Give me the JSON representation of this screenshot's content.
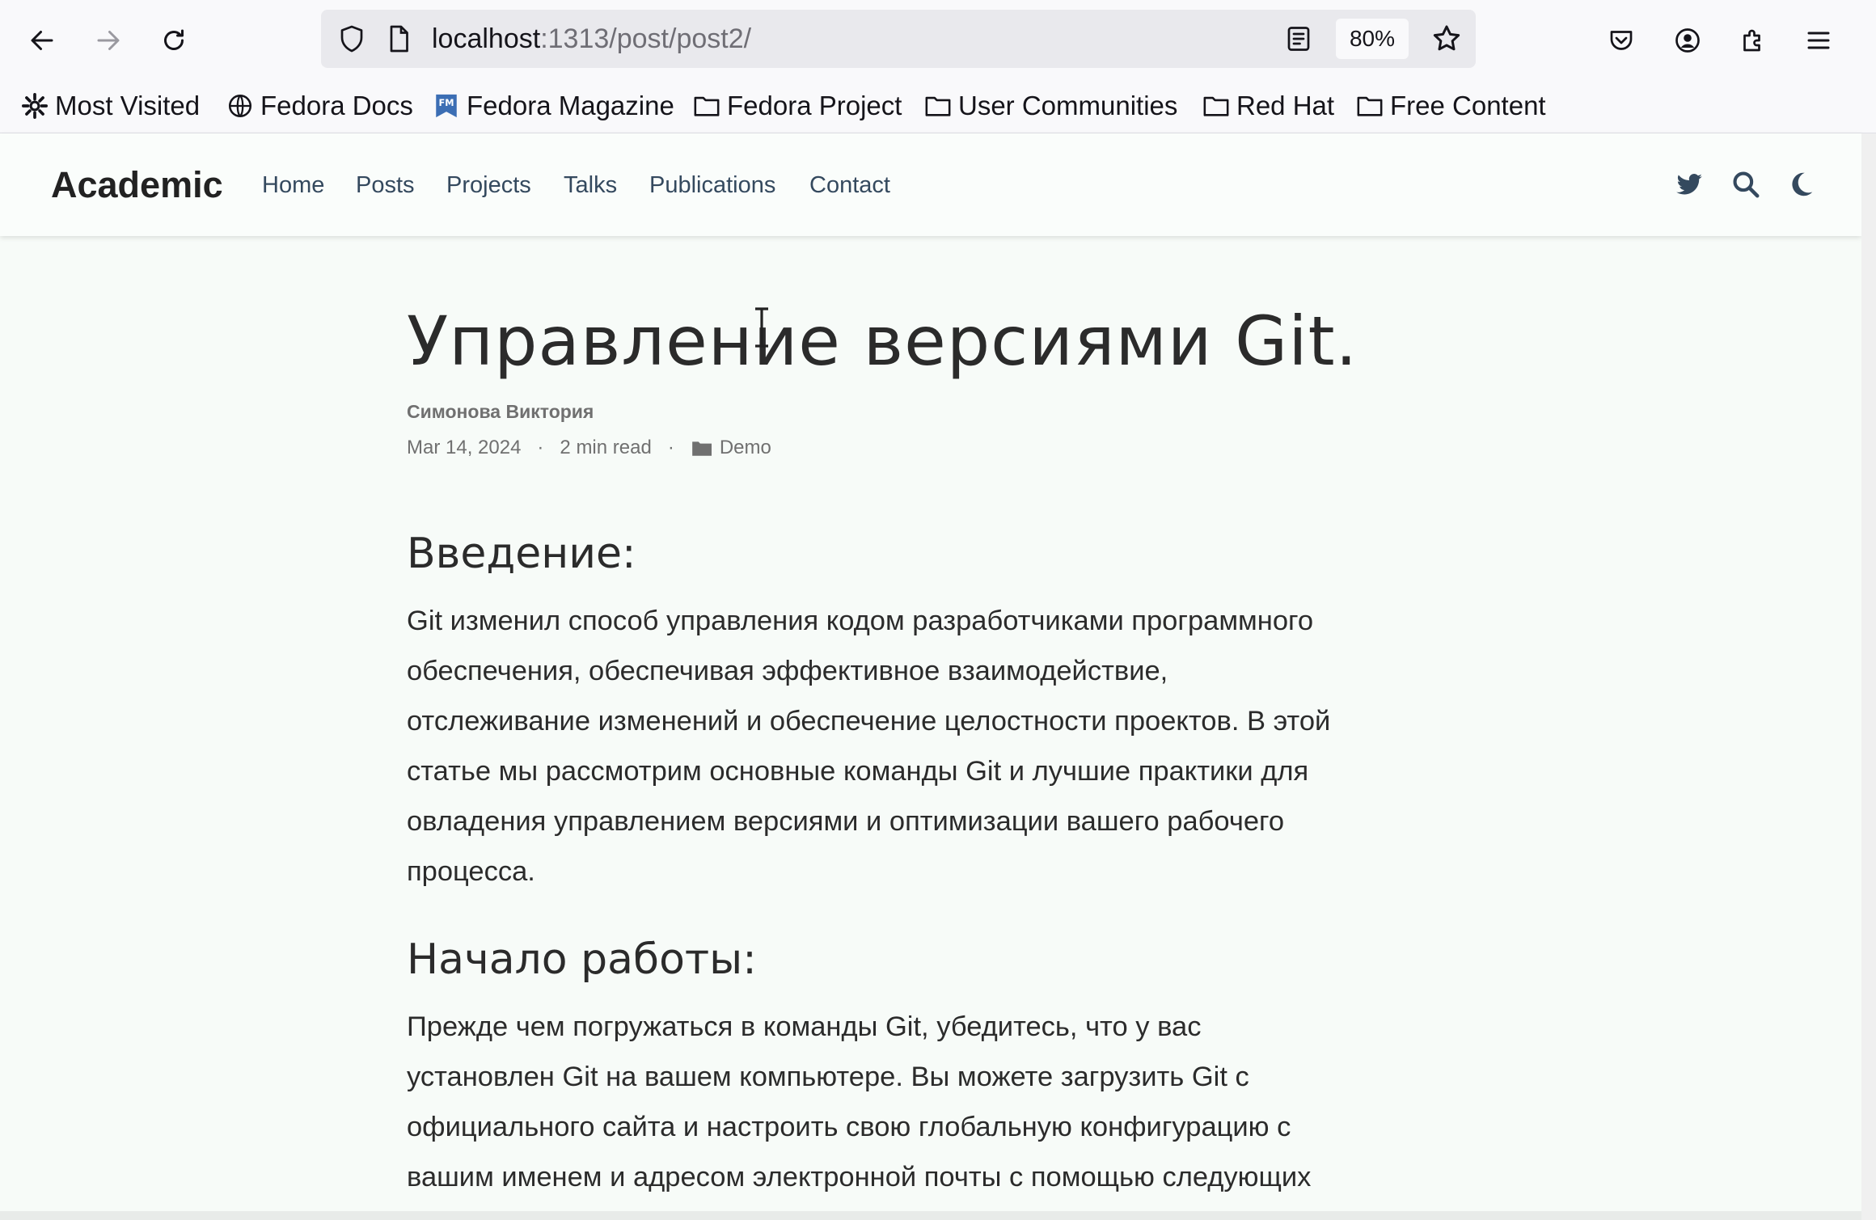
{
  "browser": {
    "url_host": "localhost",
    "url_path": ":1313/post/post2/",
    "zoom": "80%"
  },
  "bookmarks": [
    {
      "label": "Most Visited",
      "icon": "gear-icon"
    },
    {
      "label": "Fedora Docs",
      "icon": "globe-icon"
    },
    {
      "label": "Fedora Magazine",
      "icon": "fedora-magazine-icon"
    },
    {
      "label": "Fedora Project",
      "icon": "folder-icon"
    },
    {
      "label": "User Communities",
      "icon": "folder-icon"
    },
    {
      "label": "Red Hat",
      "icon": "folder-icon"
    },
    {
      "label": "Free Content",
      "icon": "folder-icon"
    }
  ],
  "site": {
    "brand": "Academic",
    "nav": [
      "Home",
      "Posts",
      "Projects",
      "Talks",
      "Publications",
      "Contact"
    ],
    "nav_icons": [
      "twitter-icon",
      "search-icon",
      "moon-icon"
    ]
  },
  "article": {
    "title": "Управление версиями Git.",
    "author": "Симонова Виктория",
    "date": "Mar 14, 2024",
    "reading_time": "2 min read",
    "category": "Demo",
    "sections": [
      {
        "heading": "Введение:",
        "lines": [
          "Git изменил способ управления кодом разработчиками программного",
          "обеспечения, обеспечивая эффективное взаимодействие,",
          "отслеживание изменений и обеспечение целостности проектов. В этой",
          "статье мы рассмотрим основные команды Git и лучшие практики для",
          "овладения управлением версиями и оптимизации вашего рабочего",
          "процесса."
        ]
      },
      {
        "heading": "Начало работы:",
        "lines": [
          "Прежде чем погружаться в команды Git, убедитесь, что у вас",
          "установлен Git на вашем компьютере. Вы можете загрузить Git с",
          "официального сайта и настроить свою глобальную конфигурацию с",
          "вашим именем и адресом электронной почты с помощью следующих"
        ]
      }
    ]
  },
  "colors": {
    "page_bg": "#f7fbf8",
    "nav_link": "#34495e",
    "meta_text": "#707070"
  }
}
